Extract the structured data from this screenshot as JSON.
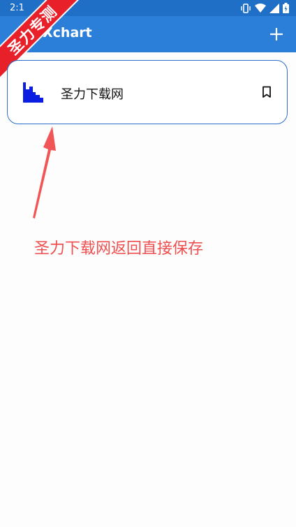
{
  "status_bar": {
    "time": "2:1"
  },
  "app_bar": {
    "title": "Xchart",
    "add_icon": "plus-icon"
  },
  "watermark": {
    "text": "圣力专测"
  },
  "list": {
    "items": [
      {
        "title": "圣力下载网",
        "icon": "bar-chart-icon",
        "action_icon": "bookmark-icon"
      }
    ]
  },
  "annotation": {
    "text": "圣力下载网返回直接保存"
  },
  "colors": {
    "status_bar": "#1f6fc7",
    "app_bar": "#2b7fd8",
    "card_border": "#2a6fc4",
    "chart_icon": "#0a1de0",
    "annotation": "#ef4f4f",
    "watermark": "#e8202a"
  }
}
